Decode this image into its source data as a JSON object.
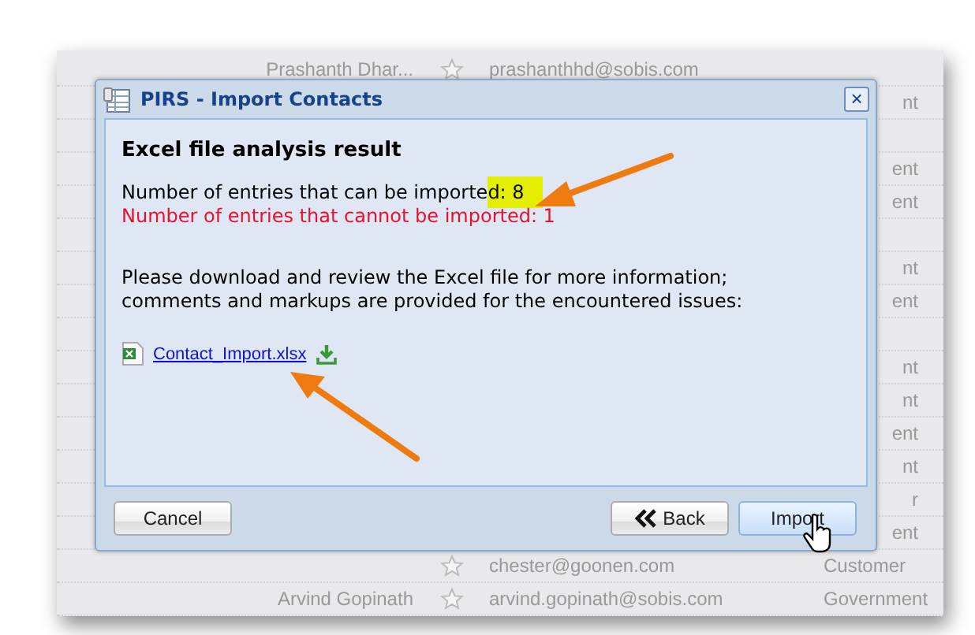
{
  "background_list": {
    "rows": [
      {
        "name": "Prashanth Dhar...",
        "email": "prashanthhd@sobis.com",
        "type": ""
      },
      {
        "type": "nt"
      },
      {
        "type": ""
      },
      {
        "type": "ent"
      },
      {
        "type": "ent"
      },
      {
        "type": ""
      },
      {
        "type": "nt"
      },
      {
        "type": "ent"
      },
      {
        "type": ""
      },
      {
        "type": "nt"
      },
      {
        "type": "nt"
      },
      {
        "type": "ent"
      },
      {
        "type": "nt"
      },
      {
        "type": "r"
      },
      {
        "type": "ent"
      },
      {
        "email": "chester@goonen.com",
        "type": "Customer"
      },
      {
        "name": "Arvind Gopinath",
        "email": "arvind.gopinath@sobis.com",
        "type": "Government"
      }
    ]
  },
  "dialog": {
    "title": "PIRS - Import Contacts",
    "close": "×",
    "heading": "Excel file analysis result",
    "importable": {
      "text": "Number of entries that can be importe",
      "highlighted": "d: 8"
    },
    "not_importable": "Number of entries that cannot be imported: 1",
    "message": "Please download and review the Excel file for more information; comments and markups are provided for the encountered issues:",
    "file": "Contact_Import.xlsx",
    "buttons": [
      {
        "kind": "plain",
        "label": "Cancel",
        "hovered": false
      },
      {
        "kind": "back",
        "label": "Back",
        "hovered": false
      },
      {
        "kind": "plain",
        "label": "Import",
        "hovered": true
      }
    ]
  }
}
